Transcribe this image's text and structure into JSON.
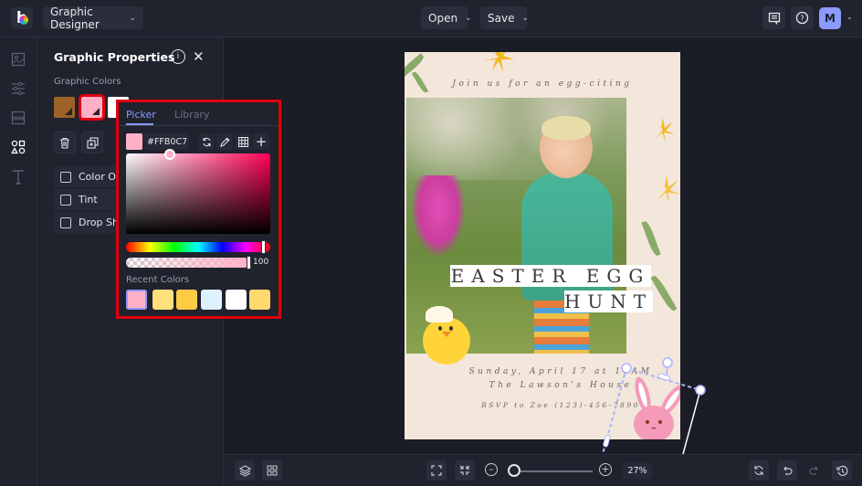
{
  "app": {
    "mode_label": "Graphic Designer",
    "open_label": "Open",
    "save_label": "Save",
    "avatar_initial": "M"
  },
  "rail": {
    "items": [
      {
        "name": "image-icon"
      },
      {
        "name": "adjust-icon"
      },
      {
        "name": "layout-icon"
      },
      {
        "name": "shapes-icon",
        "active": true
      },
      {
        "name": "text-icon"
      }
    ]
  },
  "panel": {
    "title": "Graphic Properties",
    "colors_label": "Graphic Colors",
    "swatches": [
      "#9c6327",
      "#ffb0c7",
      "#ffffff"
    ],
    "options": [
      "Color Overlay",
      "Tint",
      "Drop Shadow"
    ],
    "options_visible": [
      "Color Ov",
      "Tint",
      "Drop Sho"
    ]
  },
  "picker": {
    "tabs": [
      "Picker",
      "Library"
    ],
    "active_tab": "Picker",
    "hex_value": "#FFB0C7",
    "opacity": "100",
    "recent_label": "Recent Colors",
    "recent_colors": [
      "#ffb0c7",
      "#ffe07a",
      "#ffcb45",
      "#ddf1ff",
      "#ffffff",
      "#ffd86e"
    ]
  },
  "poster": {
    "tagline": "Join us for an egg-citing",
    "title_line1": "EASTER EGG",
    "title_line2": "HUNT",
    "date_line": "Sunday, April 17 at 11AM",
    "location_line": "The Lawson's House",
    "rsvp_line": "RSVP to Zoe (123)-456-7890"
  },
  "bottom": {
    "zoom_value": "27%"
  }
}
